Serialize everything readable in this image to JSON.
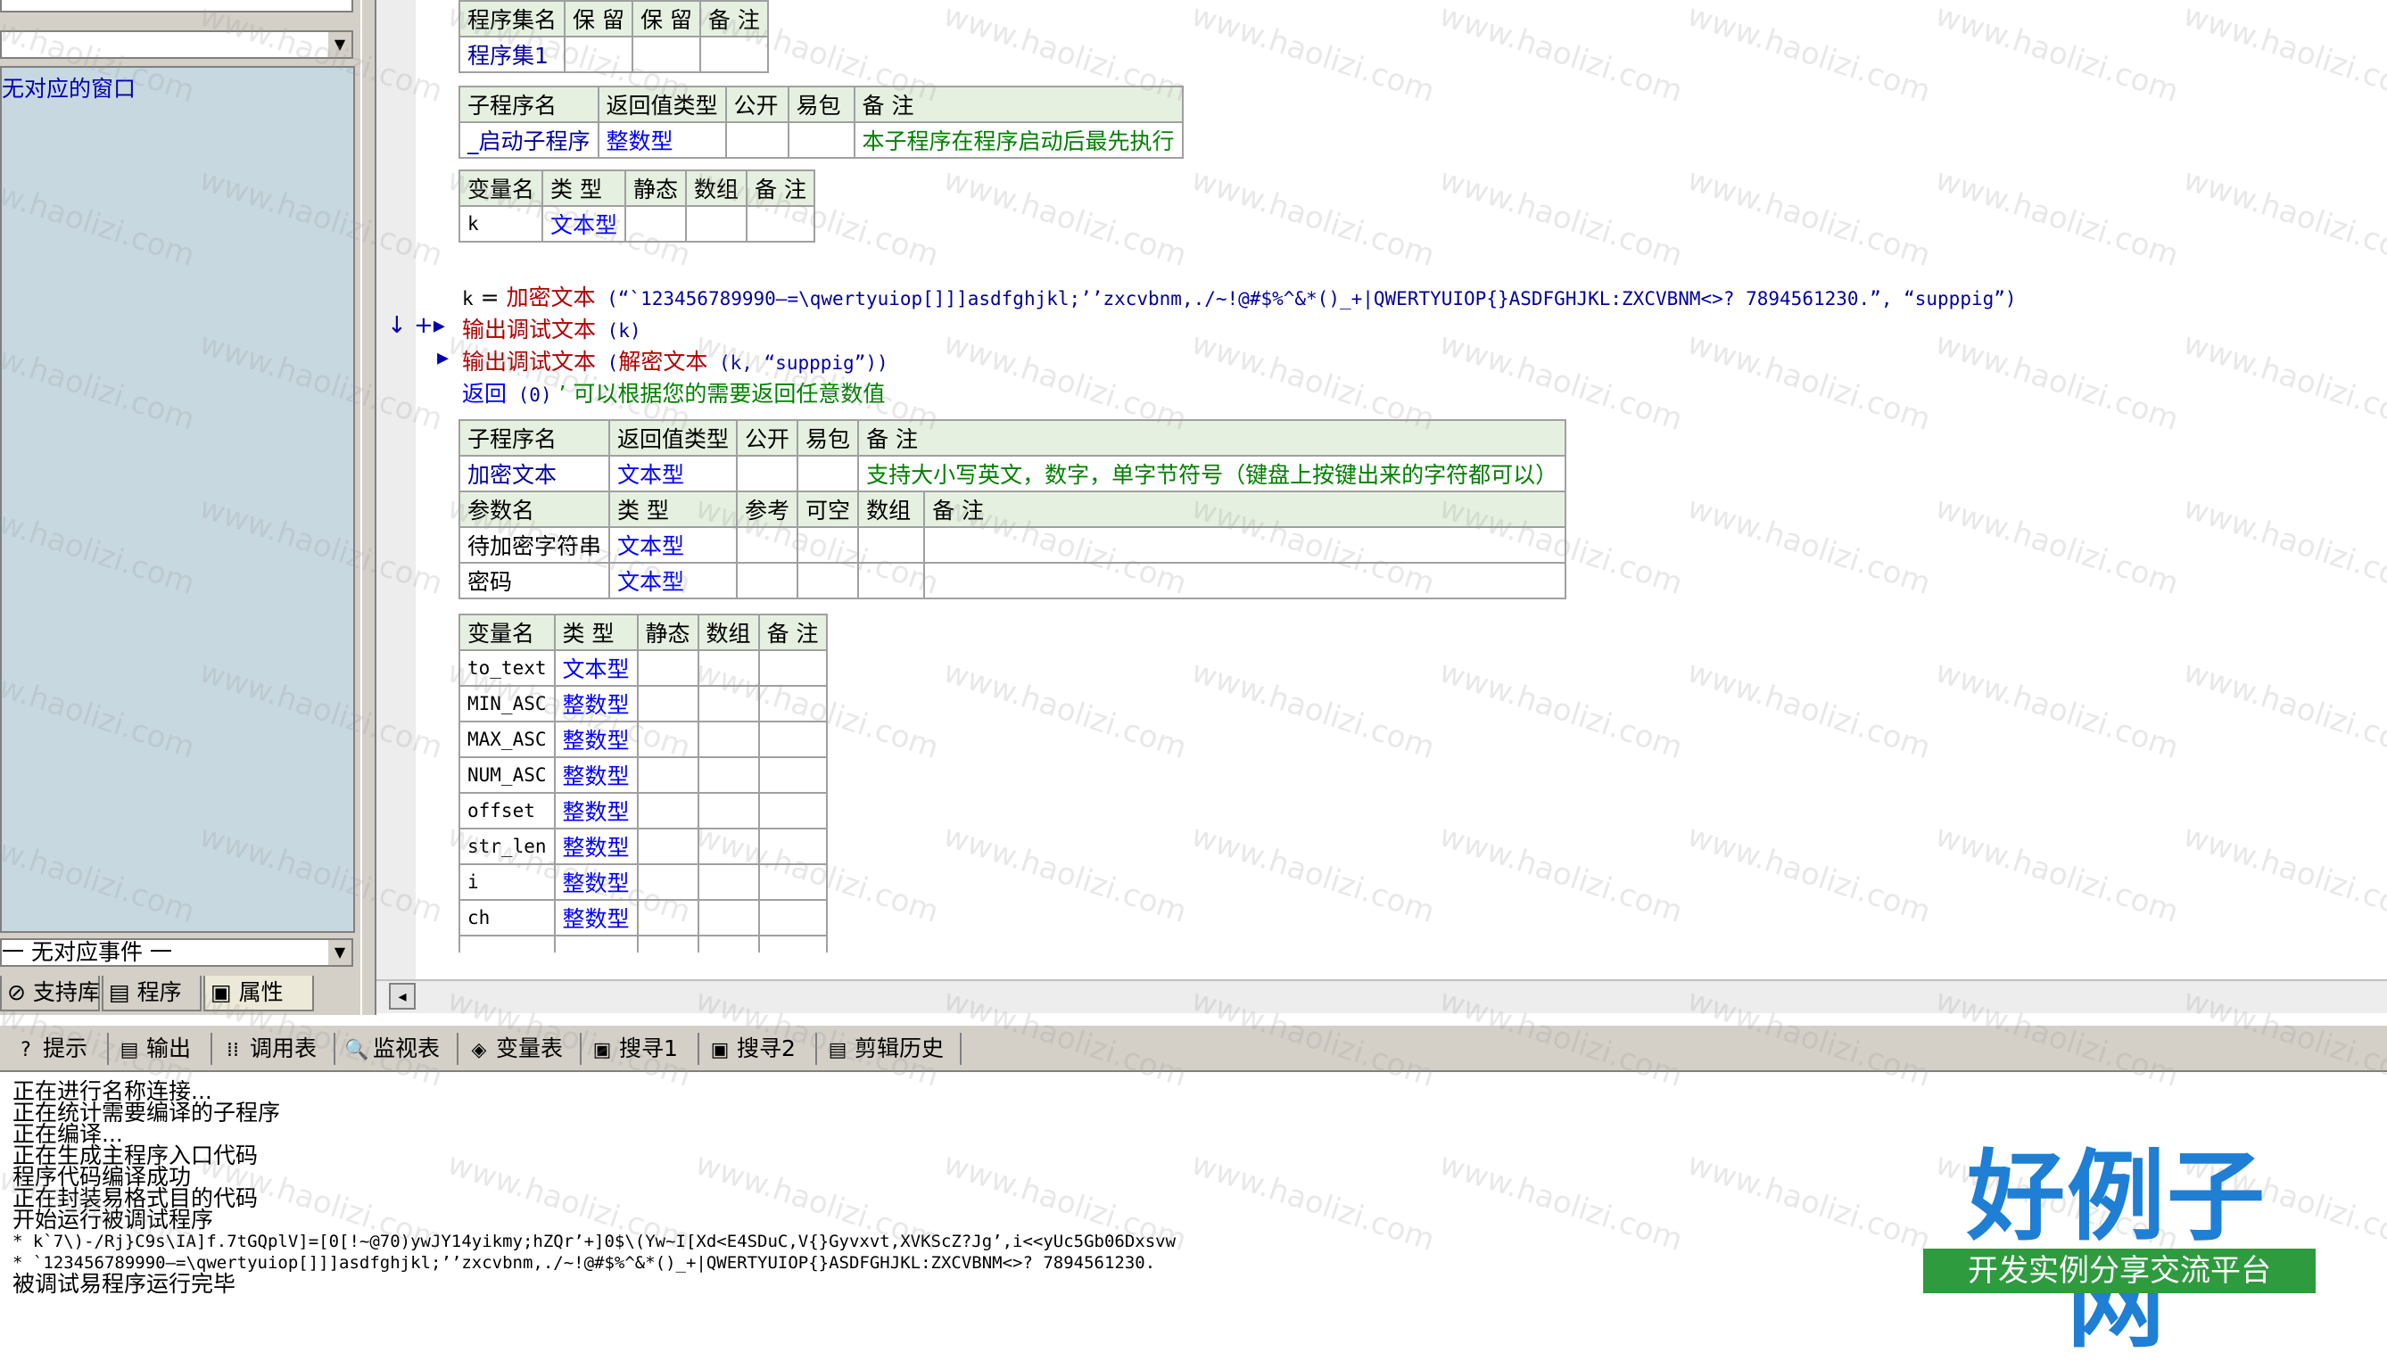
{
  "left_panel": {
    "window_list_label": "无对应的窗口",
    "event_combo": "一 无对应事件 一",
    "tabs": [
      "支持库",
      "程序",
      "属性"
    ]
  },
  "program_set": {
    "headers": [
      "程序集名",
      "保 留",
      "保 留",
      "备 注"
    ],
    "row": [
      "程序集1",
      "",
      "",
      ""
    ]
  },
  "sub1": {
    "headers": [
      "子程序名",
      "返回值类型",
      "公开",
      "易包",
      "备 注"
    ],
    "row": [
      "_启动子程序",
      "整数型",
      "",
      "",
      "本子程序在程序启动后最先执行"
    ],
    "var_headers": [
      "变量名",
      "类 型",
      "静态",
      "数组",
      "备 注"
    ],
    "vars": [
      [
        "k",
        "文本型",
        "",
        "",
        ""
      ]
    ]
  },
  "code": {
    "line1": {
      "var": "k",
      "op": " = ",
      "func": "加密文本",
      "args": " (“`123456789990–=\\qwertyuiop[]]]asdfghjkl;’’zxcvbnm,./~!@#$%^&*()_+|QWERTYUIOP{}ASDFGHJKL:ZXCVBNM<>?   7894561230.”, “supppig”)"
    },
    "line2": {
      "marker": "↓ +▸",
      "func": "输出调试文本",
      "args": " (k)"
    },
    "line3": {
      "marker": "▸",
      "func": "输出调试文本",
      "mid": " (",
      "func2": "解密文本",
      "args": " (k, “supppig”))"
    },
    "line4": {
      "kw": "返回",
      "args": " (0)",
      "comment": "  ’ 可以根据您的需要返回任意数值"
    }
  },
  "sub2": {
    "headers": [
      "子程序名",
      "返回值类型",
      "公开",
      "易包",
      "备 注"
    ],
    "row": [
      "加密文本",
      "文本型",
      "",
      "",
      "支持大小写英文，数字，单字节符号（键盘上按键出来的字符都可以）"
    ],
    "param_headers": [
      "参数名",
      "类 型",
      "参考",
      "可空",
      "数组",
      "备 注"
    ],
    "params": [
      [
        "待加密字符串",
        "文本型",
        "",
        "",
        "",
        ""
      ],
      [
        "密码",
        "文本型",
        "",
        "",
        "",
        ""
      ]
    ],
    "var_headers": [
      "变量名",
      "类 型",
      "静态",
      "数组",
      "备 注"
    ],
    "vars": [
      [
        "to_text",
        "文本型"
      ],
      [
        "MIN_ASC",
        "整数型"
      ],
      [
        "MAX_ASC",
        "整数型"
      ],
      [
        "NUM_ASC",
        "整数型"
      ],
      [
        "offset",
        "整数型"
      ],
      [
        "str_len",
        "整数型"
      ],
      [
        "i",
        "整数型"
      ],
      [
        "ch",
        "整数型"
      ]
    ]
  },
  "bottom_tabs": [
    {
      "label": "提示",
      "icon": "hint-icon"
    },
    {
      "label": "输出",
      "icon": "output-icon"
    },
    {
      "label": "调用表",
      "icon": "call-table-icon"
    },
    {
      "label": "监视表",
      "icon": "watch-icon"
    },
    {
      "label": "变量表",
      "icon": "variable-icon"
    },
    {
      "label": "搜寻1",
      "icon": "search1-icon"
    },
    {
      "label": "搜寻2",
      "icon": "search2-icon"
    },
    {
      "label": "剪辑历史",
      "icon": "clip-history-icon"
    }
  ],
  "output": [
    "正在进行名称连接...",
    "正在统计需要编译的子程序",
    "正在编译...",
    "正在生成主程序入口代码",
    "程序代码编译成功",
    "正在封装易格式目的代码",
    "开始运行被调试程序",
    "* k`7\\)-/Rj}C9s\\IA]f.7tGQplV]=[0[!~@70)ywJY14yikmy;hZQr’+]0$\\(Yw~I[Xd<E4SDuC,V{}Gyvxvt,XVKScZ?Jg’,i<<yUc5Gb06Dxsvw",
    "* `123456789990–=\\qwertyuiop[]]]asdfghjkl;’’zxcvbnm,./~!@#$%^&*()_+|QWERTYUIOP{}ASDFGHJKL:ZXCVBNM<>?   7894561230.",
    "被调试易程序运行完毕"
  ],
  "watermark": "www.haolizi.com",
  "logo": {
    "main": "好例子网",
    "sub": "开发实例分享交流平台"
  }
}
